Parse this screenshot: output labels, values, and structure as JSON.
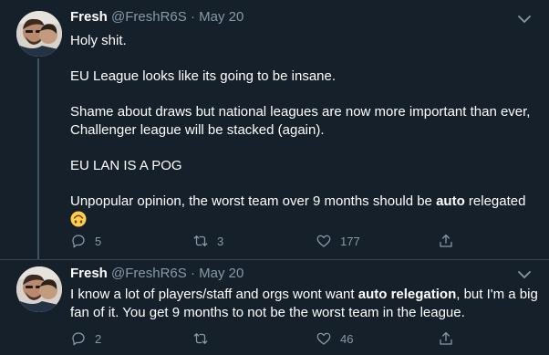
{
  "colors": {
    "background": "#15202b",
    "text_primary": "#ffffff",
    "text_secondary": "#8899a6",
    "divider": "#38444d",
    "thread_line": "#3d5466"
  },
  "tweets": [
    {
      "author": {
        "name": "Fresh",
        "handle": "@FreshR6S",
        "separator": "·",
        "date": "May 20"
      },
      "paragraphs": [
        "Holy shit.",
        "EU League looks like its going to be insane.",
        "Shame about draws but national leagues are now more important than ever, Challenger league will be stacked (again).",
        "EU LAN IS A POG"
      ],
      "last_paragraph": {
        "before": "Unpopular opinion, the worst team over 9 months should be ",
        "bold": "auto",
        "after": " relegated",
        "emoji": "upside-down-face-emoji"
      },
      "actions": {
        "reply_count": "5",
        "retweet_count": "3",
        "like_count": "177",
        "reply_icon": "reply-icon",
        "retweet_icon": "retweet-icon",
        "like_icon": "heart-icon",
        "share_icon": "share-icon"
      },
      "menu_icon": "chevron-down-icon"
    },
    {
      "author": {
        "name": "Fresh",
        "handle": "@FreshR6S",
        "separator": "·",
        "date": "May 20"
      },
      "text": {
        "before": "I know a lot of players/staff and orgs wont want ",
        "bold": "auto relegation",
        "after": ", but I'm a big fan of it. You get 9 months to not be the worst team in the league."
      },
      "actions": {
        "reply_count": "2",
        "retweet_count": "",
        "like_count": "46",
        "reply_icon": "reply-icon",
        "retweet_icon": "retweet-icon",
        "like_icon": "heart-icon",
        "share_icon": "share-icon"
      },
      "menu_icon": "chevron-down-icon"
    }
  ]
}
